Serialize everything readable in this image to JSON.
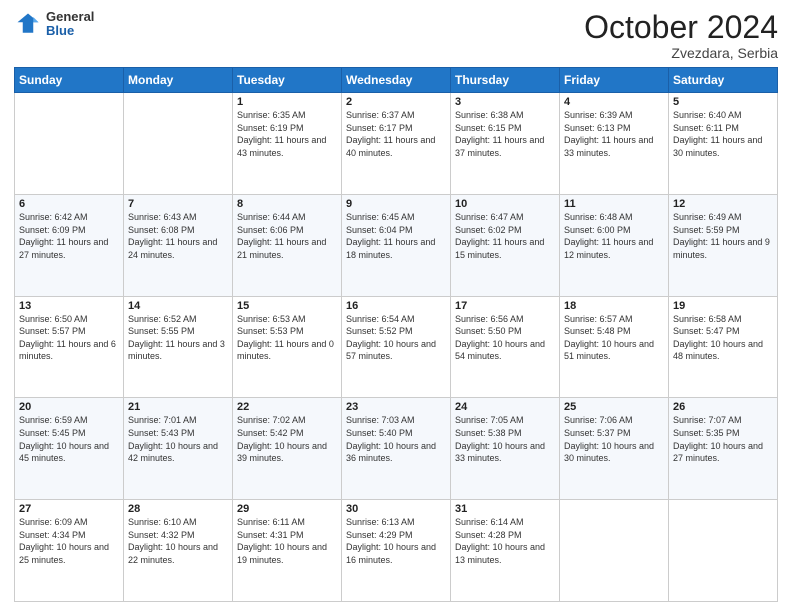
{
  "header": {
    "logo": {
      "general": "General",
      "blue": "Blue"
    },
    "month": "October 2024",
    "location": "Zvezdara, Serbia"
  },
  "weekdays": [
    "Sunday",
    "Monday",
    "Tuesday",
    "Wednesday",
    "Thursday",
    "Friday",
    "Saturday"
  ],
  "weeks": [
    [
      {
        "day": "",
        "sunrise": "",
        "sunset": "",
        "daylight": ""
      },
      {
        "day": "",
        "sunrise": "",
        "sunset": "",
        "daylight": ""
      },
      {
        "day": "1",
        "sunrise": "Sunrise: 6:35 AM",
        "sunset": "Sunset: 6:19 PM",
        "daylight": "Daylight: 11 hours and 43 minutes."
      },
      {
        "day": "2",
        "sunrise": "Sunrise: 6:37 AM",
        "sunset": "Sunset: 6:17 PM",
        "daylight": "Daylight: 11 hours and 40 minutes."
      },
      {
        "day": "3",
        "sunrise": "Sunrise: 6:38 AM",
        "sunset": "Sunset: 6:15 PM",
        "daylight": "Daylight: 11 hours and 37 minutes."
      },
      {
        "day": "4",
        "sunrise": "Sunrise: 6:39 AM",
        "sunset": "Sunset: 6:13 PM",
        "daylight": "Daylight: 11 hours and 33 minutes."
      },
      {
        "day": "5",
        "sunrise": "Sunrise: 6:40 AM",
        "sunset": "Sunset: 6:11 PM",
        "daylight": "Daylight: 11 hours and 30 minutes."
      }
    ],
    [
      {
        "day": "6",
        "sunrise": "Sunrise: 6:42 AM",
        "sunset": "Sunset: 6:09 PM",
        "daylight": "Daylight: 11 hours and 27 minutes."
      },
      {
        "day": "7",
        "sunrise": "Sunrise: 6:43 AM",
        "sunset": "Sunset: 6:08 PM",
        "daylight": "Daylight: 11 hours and 24 minutes."
      },
      {
        "day": "8",
        "sunrise": "Sunrise: 6:44 AM",
        "sunset": "Sunset: 6:06 PM",
        "daylight": "Daylight: 11 hours and 21 minutes."
      },
      {
        "day": "9",
        "sunrise": "Sunrise: 6:45 AM",
        "sunset": "Sunset: 6:04 PM",
        "daylight": "Daylight: 11 hours and 18 minutes."
      },
      {
        "day": "10",
        "sunrise": "Sunrise: 6:47 AM",
        "sunset": "Sunset: 6:02 PM",
        "daylight": "Daylight: 11 hours and 15 minutes."
      },
      {
        "day": "11",
        "sunrise": "Sunrise: 6:48 AM",
        "sunset": "Sunset: 6:00 PM",
        "daylight": "Daylight: 11 hours and 12 minutes."
      },
      {
        "day": "12",
        "sunrise": "Sunrise: 6:49 AM",
        "sunset": "Sunset: 5:59 PM",
        "daylight": "Daylight: 11 hours and 9 minutes."
      }
    ],
    [
      {
        "day": "13",
        "sunrise": "Sunrise: 6:50 AM",
        "sunset": "Sunset: 5:57 PM",
        "daylight": "Daylight: 11 hours and 6 minutes."
      },
      {
        "day": "14",
        "sunrise": "Sunrise: 6:52 AM",
        "sunset": "Sunset: 5:55 PM",
        "daylight": "Daylight: 11 hours and 3 minutes."
      },
      {
        "day": "15",
        "sunrise": "Sunrise: 6:53 AM",
        "sunset": "Sunset: 5:53 PM",
        "daylight": "Daylight: 11 hours and 0 minutes."
      },
      {
        "day": "16",
        "sunrise": "Sunrise: 6:54 AM",
        "sunset": "Sunset: 5:52 PM",
        "daylight": "Daylight: 10 hours and 57 minutes."
      },
      {
        "day": "17",
        "sunrise": "Sunrise: 6:56 AM",
        "sunset": "Sunset: 5:50 PM",
        "daylight": "Daylight: 10 hours and 54 minutes."
      },
      {
        "day": "18",
        "sunrise": "Sunrise: 6:57 AM",
        "sunset": "Sunset: 5:48 PM",
        "daylight": "Daylight: 10 hours and 51 minutes."
      },
      {
        "day": "19",
        "sunrise": "Sunrise: 6:58 AM",
        "sunset": "Sunset: 5:47 PM",
        "daylight": "Daylight: 10 hours and 48 minutes."
      }
    ],
    [
      {
        "day": "20",
        "sunrise": "Sunrise: 6:59 AM",
        "sunset": "Sunset: 5:45 PM",
        "daylight": "Daylight: 10 hours and 45 minutes."
      },
      {
        "day": "21",
        "sunrise": "Sunrise: 7:01 AM",
        "sunset": "Sunset: 5:43 PM",
        "daylight": "Daylight: 10 hours and 42 minutes."
      },
      {
        "day": "22",
        "sunrise": "Sunrise: 7:02 AM",
        "sunset": "Sunset: 5:42 PM",
        "daylight": "Daylight: 10 hours and 39 minutes."
      },
      {
        "day": "23",
        "sunrise": "Sunrise: 7:03 AM",
        "sunset": "Sunset: 5:40 PM",
        "daylight": "Daylight: 10 hours and 36 minutes."
      },
      {
        "day": "24",
        "sunrise": "Sunrise: 7:05 AM",
        "sunset": "Sunset: 5:38 PM",
        "daylight": "Daylight: 10 hours and 33 minutes."
      },
      {
        "day": "25",
        "sunrise": "Sunrise: 7:06 AM",
        "sunset": "Sunset: 5:37 PM",
        "daylight": "Daylight: 10 hours and 30 minutes."
      },
      {
        "day": "26",
        "sunrise": "Sunrise: 7:07 AM",
        "sunset": "Sunset: 5:35 PM",
        "daylight": "Daylight: 10 hours and 27 minutes."
      }
    ],
    [
      {
        "day": "27",
        "sunrise": "Sunrise: 6:09 AM",
        "sunset": "Sunset: 4:34 PM",
        "daylight": "Daylight: 10 hours and 25 minutes."
      },
      {
        "day": "28",
        "sunrise": "Sunrise: 6:10 AM",
        "sunset": "Sunset: 4:32 PM",
        "daylight": "Daylight: 10 hours and 22 minutes."
      },
      {
        "day": "29",
        "sunrise": "Sunrise: 6:11 AM",
        "sunset": "Sunset: 4:31 PM",
        "daylight": "Daylight: 10 hours and 19 minutes."
      },
      {
        "day": "30",
        "sunrise": "Sunrise: 6:13 AM",
        "sunset": "Sunset: 4:29 PM",
        "daylight": "Daylight: 10 hours and 16 minutes."
      },
      {
        "day": "31",
        "sunrise": "Sunrise: 6:14 AM",
        "sunset": "Sunset: 4:28 PM",
        "daylight": "Daylight: 10 hours and 13 minutes."
      },
      {
        "day": "",
        "sunrise": "",
        "sunset": "",
        "daylight": ""
      },
      {
        "day": "",
        "sunrise": "",
        "sunset": "",
        "daylight": ""
      }
    ]
  ]
}
